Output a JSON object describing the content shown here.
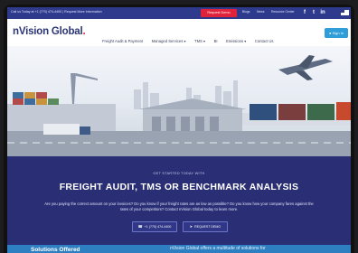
{
  "topbar": {
    "announcement": "Call us Today at +1 (770) 474-4400 | Request More Information",
    "demo_button": "Request Demo",
    "links": [
      "Blogs",
      "News",
      "Resource Center"
    ],
    "social_icons": [
      "facebook-icon",
      "twitter-icon",
      "linkedin-icon"
    ]
  },
  "nav": {
    "logo": "nVision Global",
    "logo_dot": ".",
    "items": [
      "Freight Audit & Payment",
      "Managed Services ▾",
      "TMS ▾",
      "BI",
      "Emissions ▾",
      "Contact Us"
    ],
    "signin": "Sign In"
  },
  "hero": {
    "slides": 3,
    "active_slide": 1
  },
  "banner": {
    "kicker": "GET STARTED TODAY WITH",
    "headline": "FREIGHT AUDIT, TMS OR BENCHMARK ANALYSIS",
    "paragraph": "Are you paying the correct amount on your invoices? Do you know if your freight rates are as low as possible? Do you know how your company fares against the rates of your competitors? Contact nVision Global today to learn more.",
    "phone_button": "+1 (770) 474-4400",
    "demo_button": "REQUEST DEMO"
  },
  "solutions": {
    "title": "Solutions Offered",
    "description": "nVision Global offers a multitude of solutions for"
  },
  "colors": {
    "brand_navy": "#2a2f75",
    "brand_red": "#e0233a",
    "accent_blue": "#2f9dd8"
  }
}
